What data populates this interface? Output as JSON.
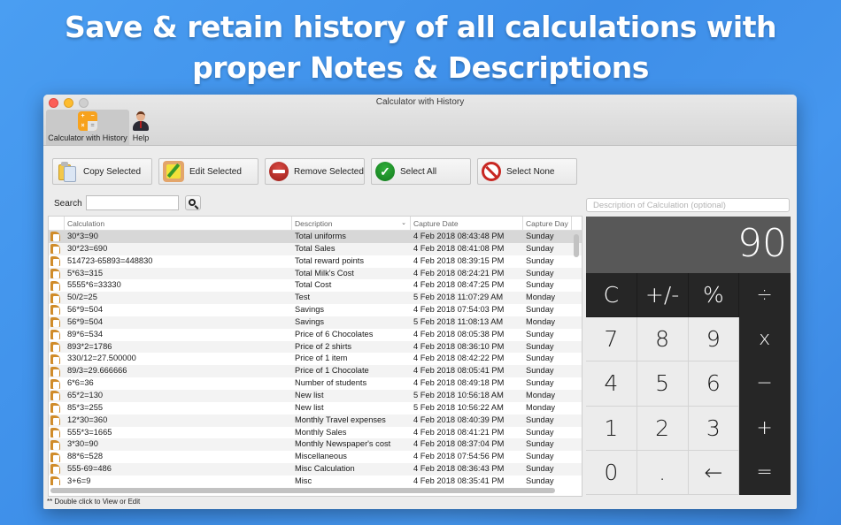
{
  "headline": {
    "line1": "Save & retain history of all calculations with",
    "line2": "proper Notes & Descriptions"
  },
  "window": {
    "title": "Calculator with History",
    "toolbar_tabs": [
      {
        "label": "Calculator with History",
        "icon": "calculator-icon",
        "active": true
      },
      {
        "label": "Help",
        "icon": "help-person-icon",
        "active": false
      }
    ]
  },
  "actions": {
    "copy": "Copy Selected",
    "edit": "Edit Selected",
    "remove": "Remove Selected",
    "select_all": "Select All",
    "select_none": "Select None"
  },
  "search": {
    "label": "Search",
    "value": "",
    "placeholder": ""
  },
  "table": {
    "columns": [
      "Calculation",
      "Description",
      "Capture Date",
      "Capture Day"
    ],
    "sorted_column": "Description",
    "rows": [
      {
        "calc": "30*3=90",
        "desc": "Total uniforms",
        "date": "4 Feb 2018 08:43:48 PM",
        "day": "Sunday",
        "selected": true
      },
      {
        "calc": "30*23=690",
        "desc": "Total Sales",
        "date": "4 Feb 2018 08:41:08 PM",
        "day": "Sunday"
      },
      {
        "calc": "514723-65893=448830",
        "desc": "Total reward points",
        "date": "4 Feb 2018 08:39:15 PM",
        "day": "Sunday"
      },
      {
        "calc": "5*63=315",
        "desc": "Total Milk's Cost",
        "date": "4 Feb 2018 08:24:21 PM",
        "day": "Sunday"
      },
      {
        "calc": "5555*6=33330",
        "desc": "Total Cost",
        "date": "4 Feb 2018 08:47:25 PM",
        "day": "Sunday"
      },
      {
        "calc": "50/2=25",
        "desc": "Test",
        "date": "5 Feb 2018 11:07:29 AM",
        "day": "Monday"
      },
      {
        "calc": "56*9=504",
        "desc": "Savings",
        "date": "4 Feb 2018 07:54:03 PM",
        "day": "Sunday"
      },
      {
        "calc": "56*9=504",
        "desc": "Savings",
        "date": "5 Feb 2018 11:08:13 AM",
        "day": "Monday"
      },
      {
        "calc": "89*6=534",
        "desc": "Price of 6 Chocolates",
        "date": "4 Feb 2018 08:05:38 PM",
        "day": "Sunday"
      },
      {
        "calc": "893*2=1786",
        "desc": "Price of 2 shirts",
        "date": "4 Feb 2018 08:36:10 PM",
        "day": "Sunday"
      },
      {
        "calc": "330/12=27.500000",
        "desc": "Price of 1 item",
        "date": "4 Feb 2018 08:42:22 PM",
        "day": "Sunday"
      },
      {
        "calc": "89/3=29.666666",
        "desc": "Price of 1 Chocolate",
        "date": "4 Feb 2018 08:05:41 PM",
        "day": "Sunday"
      },
      {
        "calc": "6*6=36",
        "desc": "Number of students",
        "date": "4 Feb 2018 08:49:18 PM",
        "day": "Sunday"
      },
      {
        "calc": "65*2=130",
        "desc": "New list",
        "date": "5 Feb 2018 10:56:18 AM",
        "day": "Monday"
      },
      {
        "calc": "85*3=255",
        "desc": "New list",
        "date": "5 Feb 2018 10:56:22 AM",
        "day": "Monday"
      },
      {
        "calc": "12*30=360",
        "desc": "Monthly Travel expenses",
        "date": "4 Feb 2018 08:40:39 PM",
        "day": "Sunday"
      },
      {
        "calc": "555*3=1665",
        "desc": "Monthly Sales",
        "date": "4 Feb 2018 08:41:21 PM",
        "day": "Sunday"
      },
      {
        "calc": "3*30=90",
        "desc": "Monthly Newspaper's cost",
        "date": "4 Feb 2018 08:37:04 PM",
        "day": "Sunday"
      },
      {
        "calc": "88*6=528",
        "desc": "Miscellaneous",
        "date": "4 Feb 2018 07:54:56 PM",
        "day": "Sunday"
      },
      {
        "calc": "555-69=486",
        "desc": "Misc Calculation",
        "date": "4 Feb 2018 08:36:43 PM",
        "day": "Sunday"
      },
      {
        "calc": "3+6=9",
        "desc": "Misc",
        "date": "4 Feb 2018 08:35:41 PM",
        "day": "Sunday"
      }
    ]
  },
  "footnote": "** Double click to View or Edit",
  "calculator": {
    "description_placeholder": "Description of Calculation (optional)",
    "description_value": "",
    "display": "90",
    "keys": [
      {
        "label": "C",
        "name": "clear",
        "style": "dark"
      },
      {
        "label": "+/-",
        "name": "negate",
        "style": "dark"
      },
      {
        "label": "%",
        "name": "percent",
        "style": "dark"
      },
      {
        "label": "÷",
        "name": "divide",
        "style": "op"
      },
      {
        "label": "7",
        "name": "digit-7",
        "style": "light"
      },
      {
        "label": "8",
        "name": "digit-8",
        "style": "light"
      },
      {
        "label": "9",
        "name": "digit-9",
        "style": "light"
      },
      {
        "label": "x",
        "name": "multiply",
        "style": "op"
      },
      {
        "label": "4",
        "name": "digit-4",
        "style": "light"
      },
      {
        "label": "5",
        "name": "digit-5",
        "style": "light"
      },
      {
        "label": "6",
        "name": "digit-6",
        "style": "light"
      },
      {
        "label": "−",
        "name": "subtract",
        "style": "op"
      },
      {
        "label": "1",
        "name": "digit-1",
        "style": "light"
      },
      {
        "label": "2",
        "name": "digit-2",
        "style": "light"
      },
      {
        "label": "3",
        "name": "digit-3",
        "style": "light"
      },
      {
        "label": "+",
        "name": "add",
        "style": "op"
      },
      {
        "label": "0",
        "name": "digit-0",
        "style": "light"
      },
      {
        "label": ".",
        "name": "decimal",
        "style": "light"
      },
      {
        "label": "←",
        "name": "backspace",
        "style": "light"
      },
      {
        "label": "=",
        "name": "equals",
        "style": "op"
      }
    ]
  },
  "colors": {
    "background_blue": "#4596ee",
    "display_bg": "#585858",
    "operator_bg": "#262626",
    "digit_bg": "#ececec",
    "accent_orange": "#f7a21d"
  }
}
